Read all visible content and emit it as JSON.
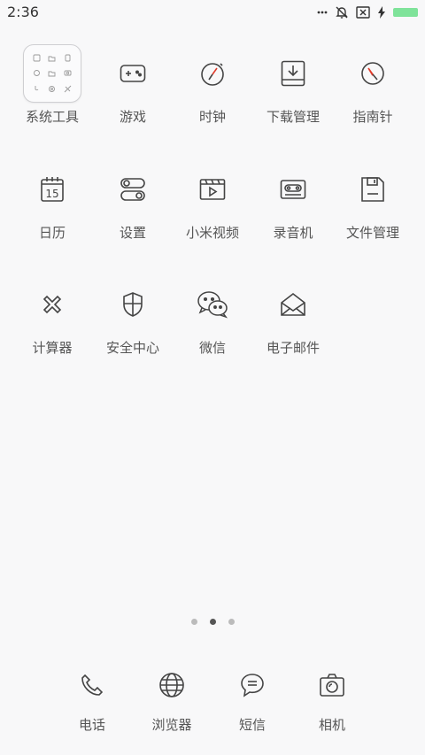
{
  "status": {
    "time": "2:36",
    "icons": [
      "more-dots-icon",
      "mute-bell-icon",
      "sim-off-icon",
      "charging-bolt-icon",
      "battery-icon"
    ],
    "battery_color": "#7fe39a"
  },
  "apps": [
    {
      "label": "系统工具",
      "icon": "folder-icon"
    },
    {
      "label": "游戏",
      "icon": "gamepad-icon"
    },
    {
      "label": "时钟",
      "icon": "clock-icon"
    },
    {
      "label": "下载管理",
      "icon": "download-icon"
    },
    {
      "label": "指南针",
      "icon": "compass-icon"
    },
    {
      "label": "日历",
      "icon": "calendar-icon",
      "badge": "15"
    },
    {
      "label": "设置",
      "icon": "settings-toggle-icon"
    },
    {
      "label": "小米视频",
      "icon": "video-icon"
    },
    {
      "label": "录音机",
      "icon": "recorder-icon"
    },
    {
      "label": "文件管理",
      "icon": "file-manager-icon"
    },
    {
      "label": "计算器",
      "icon": "calculator-icon"
    },
    {
      "label": "安全中心",
      "icon": "shield-icon"
    },
    {
      "label": "微信",
      "icon": "wechat-icon"
    },
    {
      "label": "电子邮件",
      "icon": "email-icon"
    }
  ],
  "page_indicator": {
    "count": 3,
    "active": 2
  },
  "dock": [
    {
      "label": "电话",
      "icon": "phone-icon"
    },
    {
      "label": "浏览器",
      "icon": "globe-icon"
    },
    {
      "label": "短信",
      "icon": "message-icon"
    },
    {
      "label": "相机",
      "icon": "camera-icon"
    }
  ]
}
